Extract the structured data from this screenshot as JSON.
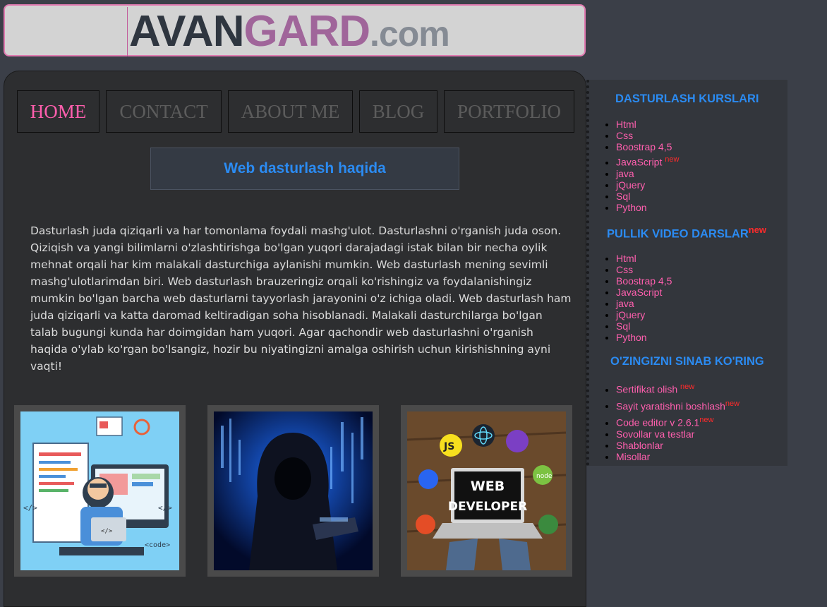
{
  "header": {
    "logo_part1": "AVAN",
    "logo_part2": "GARD",
    "logo_part3": ".com"
  },
  "nav": {
    "items": [
      "HOME",
      "CONTACT",
      "ABOUT ME",
      "BLOG",
      "PORTFOLIO"
    ],
    "active_index": 0
  },
  "main": {
    "section_title": "Web dasturlash haqida",
    "paragraph": "Dasturlash juda qiziqarli va har tomonlama foydali mashg'ulot. Dasturlashni o'rganish juda oson. Qiziqish va yangi bilimlarni o'zlashtirishga bo'lgan yuqori darajadagi istak bilan bir necha oylik mehnat orqali har kim malakali dasturchiga aylanishi mumkin. Web dasturlash mening sevimli mashg'ulotlarimdan biri. Web dasturlash brauzeringiz orqali ko'rishingiz va foydalanishingiz mumkin bo'lgan barcha web dasturlarni tayyorlash jarayonini o'z ichiga oladi. Web dasturlash ham juda qiziqarli va katta daromad keltiradigan soha hisoblanadi. Malakali dasturchilarga bo'lgan talab bugungi kunda har doimgidan ham yuqori. Agar qachondir web dasturlashni o'rganish haqida o'ylab ko'rgan bo'lsangiz, hozir bu niyatingizni amalga oshirish uchun kirishishning ayni vaqti!",
    "images": [
      {
        "icon": "web-developer-illustration",
        "labels": [
          "</>",
          "</>",
          "<code>"
        ]
      },
      {
        "icon": "hooded-hacker-image"
      },
      {
        "icon": "web-developer-laptop-image",
        "labels": [
          "JS",
          "WEB",
          "DEVELOPER",
          "node"
        ]
      }
    ]
  },
  "sidebar": {
    "new_badge": "new",
    "section1": {
      "title": "DASTURLASH KURSLARI",
      "items": [
        "Html",
        "Css",
        "Boostrap 4,5",
        "JavaScript",
        "java",
        "jQuery",
        "Sql",
        "Python"
      ]
    },
    "section2": {
      "title": "PULLIK VIDEO DARSLAR",
      "items": [
        "Html",
        "Css",
        "Boostrap 4,5",
        "JavaScript",
        "java",
        "jQuery",
        "Sql",
        "Python"
      ]
    },
    "section3": {
      "title": "O'ZINGIZNI SINAB KO'RING",
      "items": [
        "Sertifikat olish",
        "Sayit yaratishni boshlash",
        "Code editor v 2.6.1",
        "Sovollar va testlar",
        "Shablonlar",
        "Misollar"
      ]
    }
  },
  "colors": {
    "accent_blue": "#2b8bf2",
    "link_pink": "#ff5fae",
    "badge_red": "#ff2b2b",
    "logo_purple": "#a0659a"
  }
}
